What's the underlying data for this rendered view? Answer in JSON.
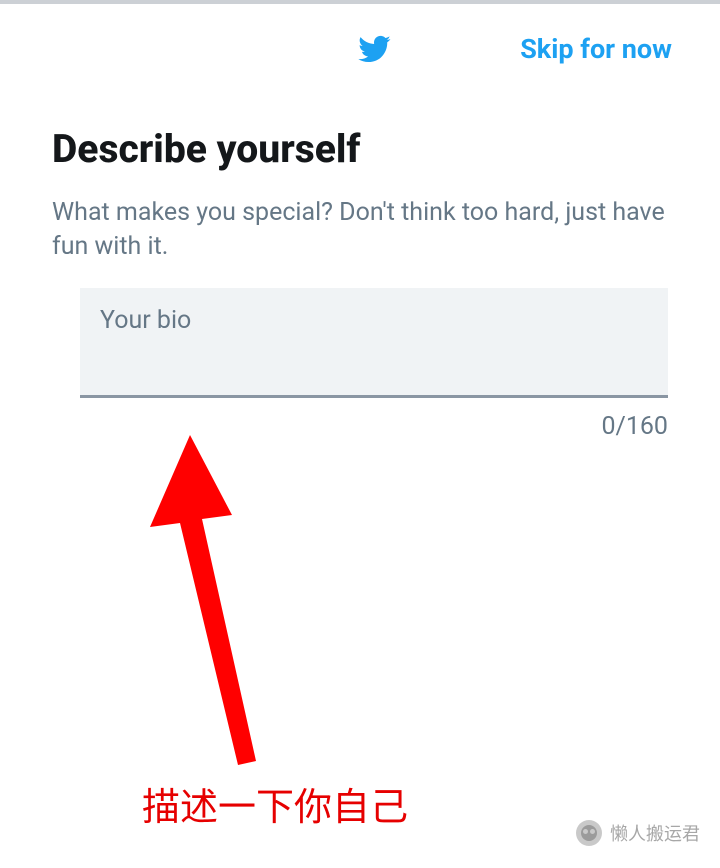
{
  "header": {
    "skip_label": "Skip for now"
  },
  "main": {
    "title": "Describe yourself",
    "subtitle": "What makes you special? Don't think too hard, just have fun with it.",
    "bio_placeholder": "Your bio",
    "bio_value": "",
    "char_count": "0/160",
    "char_limit": 160
  },
  "annotation": {
    "text": "描述一下你自己",
    "color": "#e60000"
  },
  "watermark": {
    "text": "懒人搬运君"
  },
  "colors": {
    "accent": "#1da1f2",
    "text_primary": "#14171a",
    "text_secondary": "#657786",
    "field_bg": "#f0f3f5",
    "arrow": "#ff0000"
  }
}
